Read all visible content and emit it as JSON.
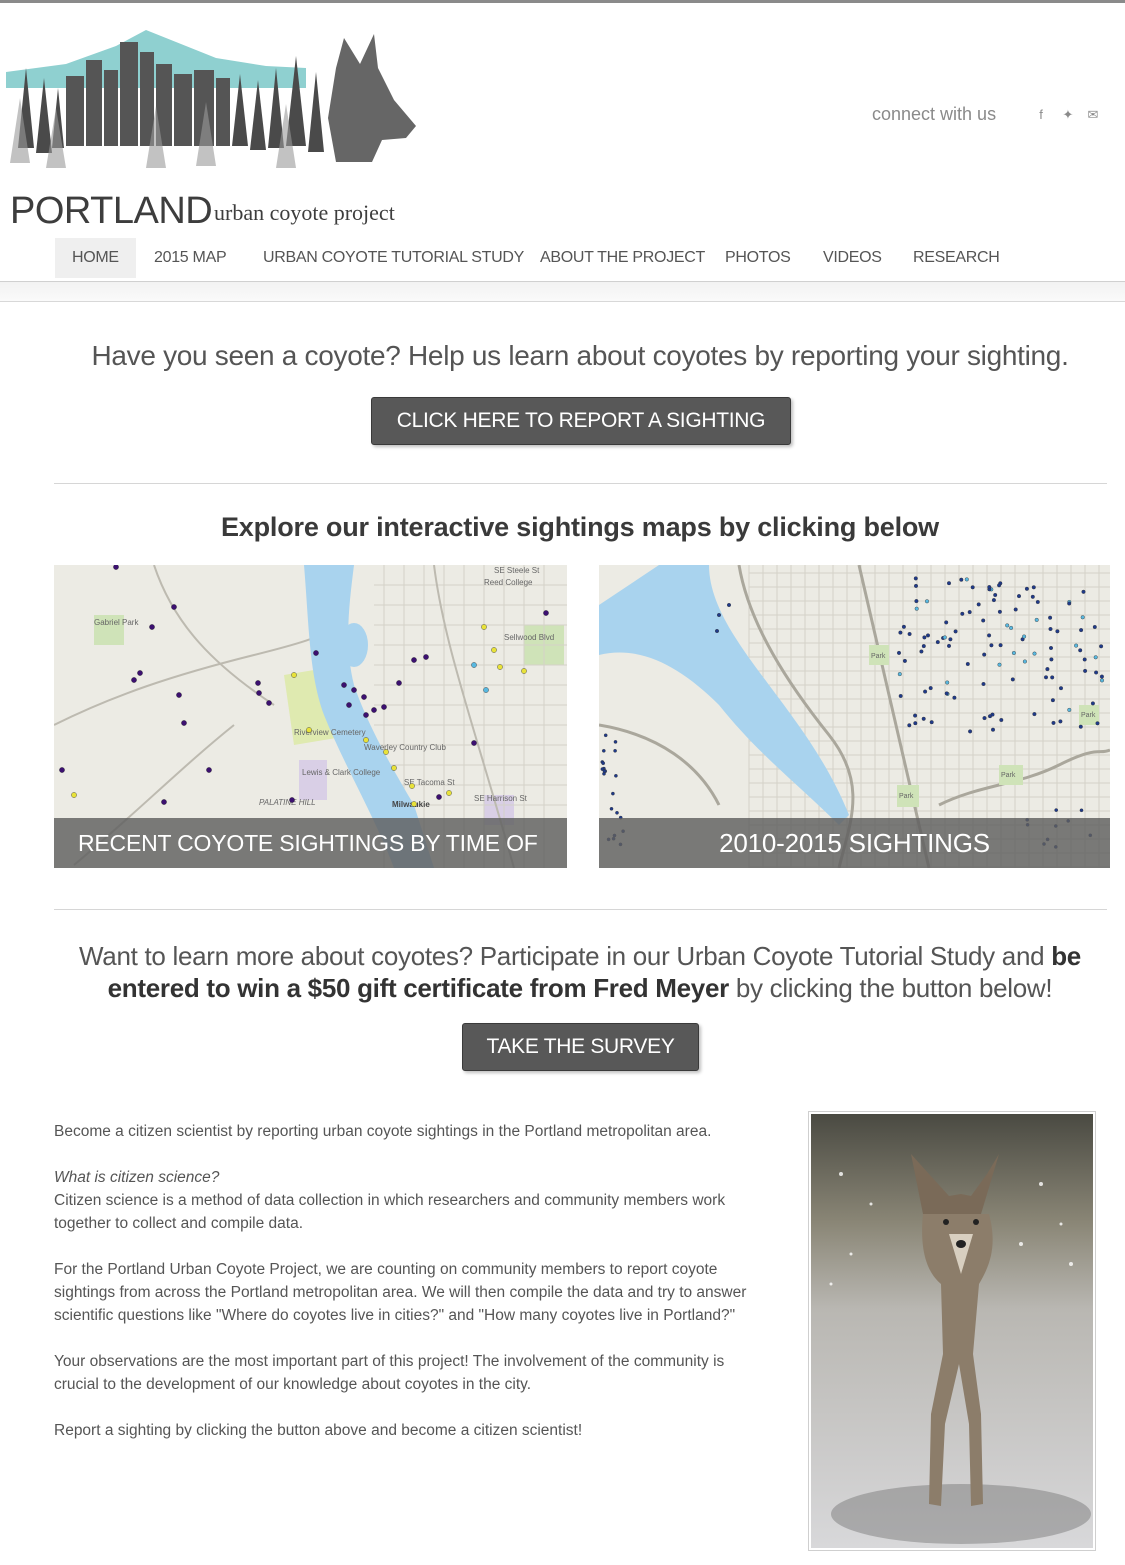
{
  "logo": {
    "word": "PORTLAND",
    "sub": "urban coyote project"
  },
  "connect": {
    "label": "connect with us",
    "icons": [
      "facebook-icon",
      "twitter-icon",
      "email-icon"
    ],
    "glyphs": [
      "f",
      "✦",
      "✉"
    ]
  },
  "nav": [
    {
      "label": "HOME",
      "active": true
    },
    {
      "label": "2015 MAP"
    },
    {
      "label": "URBAN COYOTE TUTORIAL STUDY"
    },
    {
      "label": "ABOUT THE PROJECT"
    },
    {
      "label": "PHOTOS"
    },
    {
      "label": "VIDEOS"
    },
    {
      "label": "RESEARCH"
    }
  ],
  "hero": {
    "text": "Have you seen a coyote? Help us learn about coyotes by reporting your sighting.",
    "button": "CLICK HERE TO REPORT A SIGHTING"
  },
  "maps": {
    "title": "Explore our interactive sightings maps by clicking below",
    "left_caption": "RECENT COYOTE SIGHTINGS BY TIME OF DAY",
    "right_caption": "2010-2015 SIGHTINGS",
    "left_labels": [
      "Reed College",
      "SE Steele St",
      "Gabriel Park",
      "Riverview Cemetery",
      "Waverley Country Club",
      "Lewis & Clark College",
      "PALATINE HILL",
      "Milwaukie",
      "SE Harrison St",
      "SE Tacoma St",
      "Sellwood Blvd"
    ],
    "right_labels": [
      "Park",
      "Park",
      "Park",
      "Park"
    ],
    "colors": {
      "purple": "#3c1070",
      "yellow": "#e8e23a",
      "lightblue": "#58b8e0",
      "navy": "#1f3a8a",
      "water": "#a9d3ee",
      "park": "#cfe3b8"
    }
  },
  "study": {
    "pre": "Want to learn more about coyotes? Participate in our Urban Coyote Tutorial Study and ",
    "bold": "be entered to win a $50 gift certificate from Fred Meyer",
    "post": " by clicking the button below!",
    "button": "TAKE THE SURVEY"
  },
  "body": {
    "p1": "Become a citizen scientist by reporting urban coyote sightings in the Portland metropolitan area.",
    "q": "What is citizen science?",
    "p2": "Citizen science is a method of data collection in which researchers and community members work together to collect and compile data.",
    "p3": "For the Portland Urban Coyote Project, we are counting on community members to report coyote sightings from across the Portland metropolitan area. We will then compile the data and try to answer scientific questions like \"Where do coyotes live in cities?\" and \"How many coyotes live in Portland?\"",
    "p4": "Your observations are the most important part of this project! The involvement of the community is crucial to the development of our knowledge about coyotes in the city.",
    "p5": "Report a sighting by clicking the button above and become a citizen scientist!"
  }
}
